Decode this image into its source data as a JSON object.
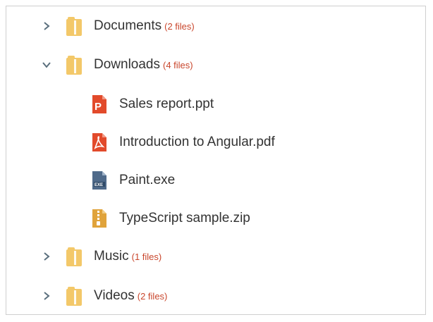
{
  "tree": {
    "folders": [
      {
        "name": "Documents",
        "count": "(2 files)",
        "expanded": false,
        "icon": "folder-icon"
      },
      {
        "name": "Downloads",
        "count": "(4 files)",
        "expanded": true,
        "icon": "folder-icon",
        "files": [
          {
            "name": "Sales report.ppt",
            "icon": "ppt-icon",
            "color": "#e24a2b"
          },
          {
            "name": "Introduction to Angular.pdf",
            "icon": "pdf-icon",
            "color": "#e24a2b"
          },
          {
            "name": "Paint.exe",
            "icon": "exe-icon",
            "color": "#4f6a8a"
          },
          {
            "name": "TypeScript sample.zip",
            "icon": "zip-icon",
            "color": "#e0a33b"
          }
        ]
      },
      {
        "name": "Music",
        "count": "(1 files)",
        "expanded": false,
        "icon": "folder-icon"
      },
      {
        "name": "Videos",
        "count": "(2 files)",
        "expanded": false,
        "icon": "folder-icon"
      }
    ]
  },
  "colors": {
    "folder": "#f3c869",
    "count": "#c9462c",
    "chevron": "#5a6f7d"
  }
}
